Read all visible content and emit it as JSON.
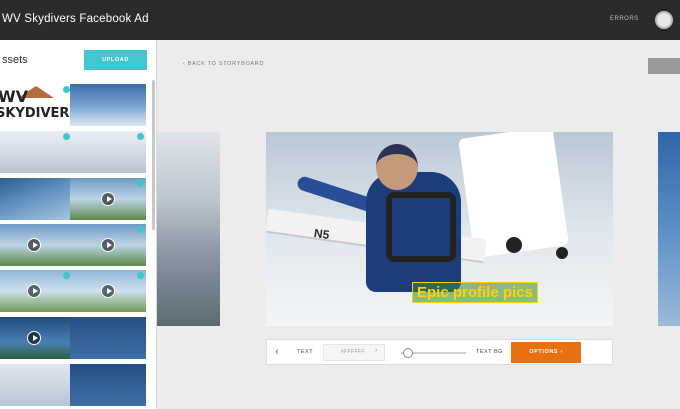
{
  "header": {
    "title": "WV Skydivers Facebook Ad",
    "user_link": "ERRORS"
  },
  "sidebar": {
    "title": "ssets",
    "upload_label": "UPLOAD",
    "logo": {
      "line1": "WV",
      "line2": "SKYDIVERS"
    }
  },
  "canvas": {
    "back_link": "‹ BACK TO STORYBOARD",
    "caption": "Epic profile pics"
  },
  "toolbar": {
    "text_label": "TEXT",
    "color_value": "#FFFFFF",
    "text_bg_label": "TEXT BG",
    "options_label": "OPTIONS ›",
    "slider_fraction": 0.1
  },
  "colors": {
    "accent_teal": "#3ec7cf",
    "accent_orange": "#e8700f",
    "topbar": "#2b2b2b",
    "caption_text": "#ffd200"
  },
  "icons": {
    "prev": "chevron-left-icon",
    "play": "play-icon",
    "check": "check-circle-icon"
  }
}
